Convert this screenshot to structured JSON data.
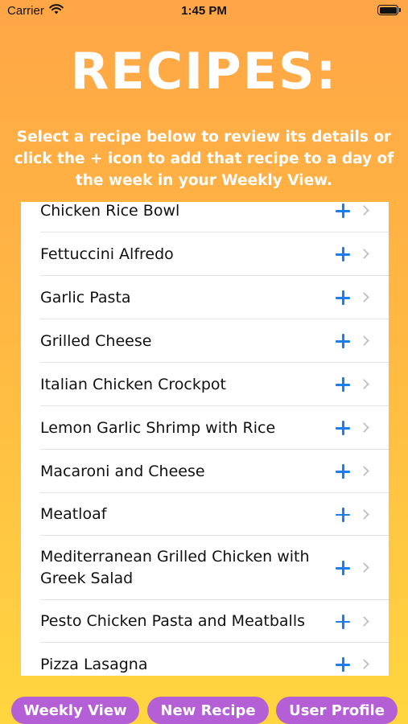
{
  "status": {
    "carrier": "Carrier",
    "time": "1:45 PM"
  },
  "header": {
    "title": "RECIPES:",
    "subtitle": "Select a recipe below to review its details or click the + icon to add that recipe to a day of the week in your Weekly View."
  },
  "recipes": [
    {
      "name": "Chicken Rice Bowl"
    },
    {
      "name": "Fettuccini Alfredo"
    },
    {
      "name": "Garlic Pasta"
    },
    {
      "name": "Grilled Cheese"
    },
    {
      "name": "Italian Chicken Crockpot"
    },
    {
      "name": "Lemon Garlic Shrimp with Rice"
    },
    {
      "name": "Macaroni and Cheese"
    },
    {
      "name": "Meatloaf"
    },
    {
      "name": "Mediterranean Grilled Chicken with Greek Salad"
    },
    {
      "name": "Pesto Chicken Pasta and Meatballs"
    },
    {
      "name": "Pizza Lasagna"
    }
  ],
  "tabs": [
    {
      "label": "Weekly View"
    },
    {
      "label": "New Recipe"
    },
    {
      "label": "User Profile"
    }
  ],
  "colors": {
    "accent": "#1a7df0",
    "button": "#b45fd6",
    "gradient_top": "#FFA646",
    "gradient_bottom": "#FFD640"
  }
}
